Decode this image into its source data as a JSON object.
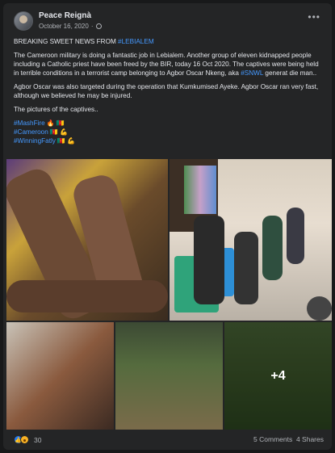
{
  "post": {
    "author": "Peace Reignà",
    "date": "October 16, 2020",
    "separator": "·",
    "more_label": "•••",
    "headline_prefix": "BREAKING SWEET NEWS FROM ",
    "headline_tag": "#LEBIALEM",
    "p1_before": "The Cameroon military is doing a fantastic job in Lebialem. Another group of eleven kidnapped people including a Catholic priest have been freed by the BIR, today 16 Oct 2020. The captives were being held in terrible conditions in a terrorist camp belonging to Agbor Oscar Nkeng, aka ",
    "p1_tag": "#SNWL",
    "p1_after": " generat die man..",
    "p2": "Agbor Oscar was also targeted during the operation that Kumkumised Ayeke. Agbor Oscar ran very fast, although we believed he may be injured.",
    "p3": "The pictures of the captives..",
    "hashtags": [
      "#MashFire",
      "#Cameroon",
      "#WinningFatly"
    ],
    "hashtag_emojis": [
      "🔥 🇨🇲",
      "🇨🇲 💪",
      "🇨🇲 💪"
    ],
    "more_photos": "+4"
  },
  "footer": {
    "reaction_count": "30",
    "comments": "5 Comments",
    "shares": "4 Shares"
  },
  "icons": [
    "avatar",
    "globe-icon",
    "more-icon",
    "like-reaction-icon",
    "wow-reaction-icon"
  ],
  "colors": {
    "background": "#18191a",
    "card": "#242526",
    "text": "#e4e6eb",
    "muted": "#b0b3b8",
    "link": "#4599ff"
  }
}
